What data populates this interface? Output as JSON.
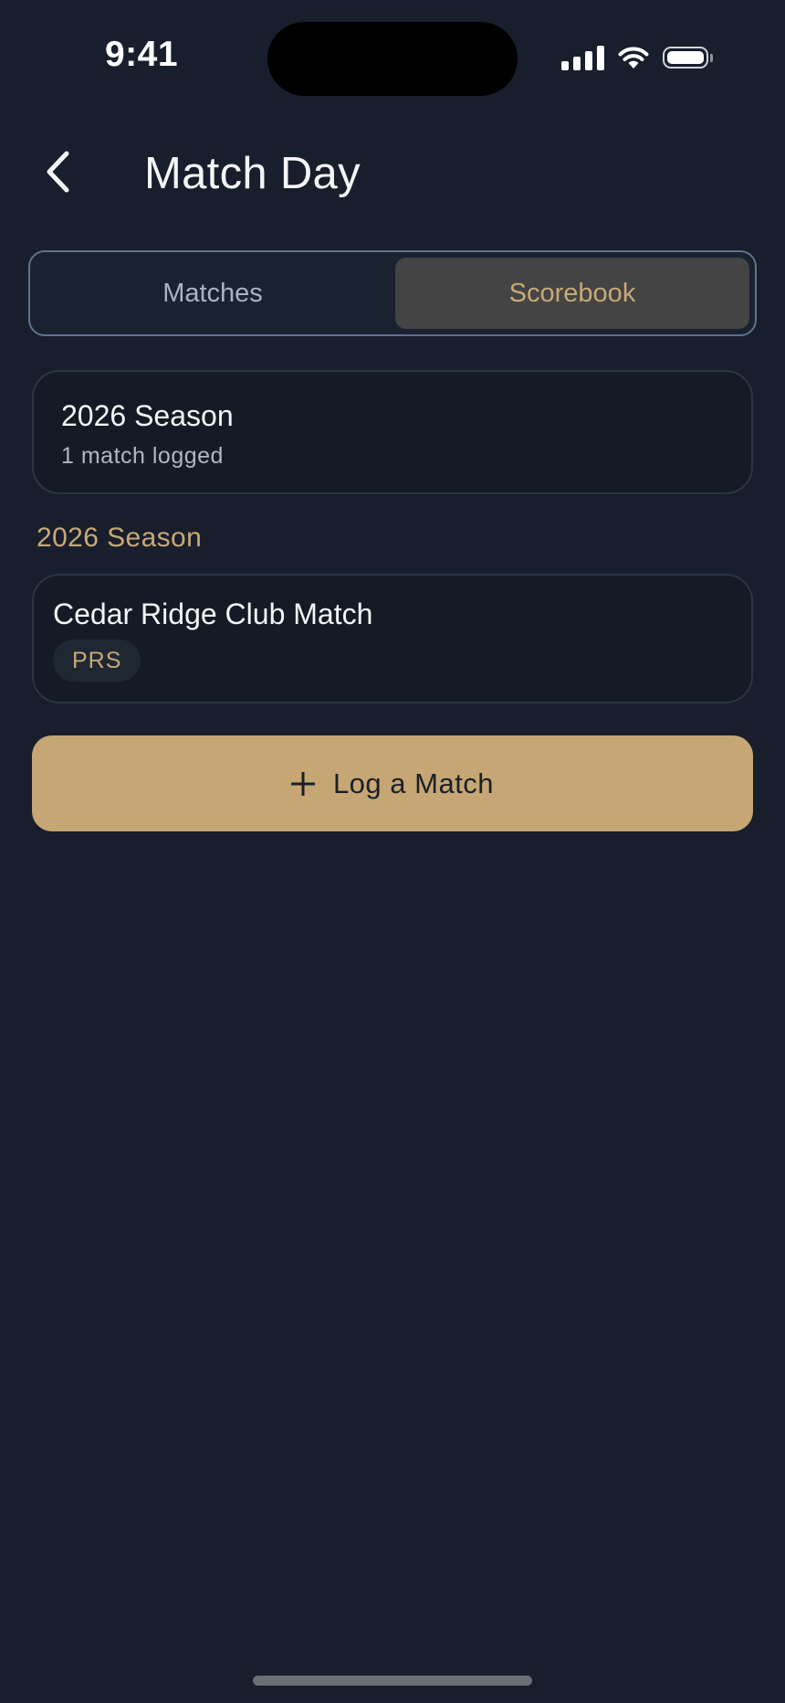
{
  "status_bar": {
    "time": "9:41"
  },
  "header": {
    "title": "Match Day"
  },
  "tabs": [
    {
      "label": "Matches",
      "active": false
    },
    {
      "label": "Scorebook",
      "active": true
    }
  ],
  "season_summary": {
    "title": "2026 Season",
    "subtitle": "1 match logged"
  },
  "section": {
    "label": "2026 Season"
  },
  "matches": [
    {
      "name": "Cedar Ridge Club Match",
      "tag": "PRS"
    }
  ],
  "primary_action": {
    "label": "Log a Match"
  },
  "colors": {
    "background": "#181e2b",
    "accent": "#c8a876",
    "button": "#c5a674",
    "card": "#141b26"
  }
}
